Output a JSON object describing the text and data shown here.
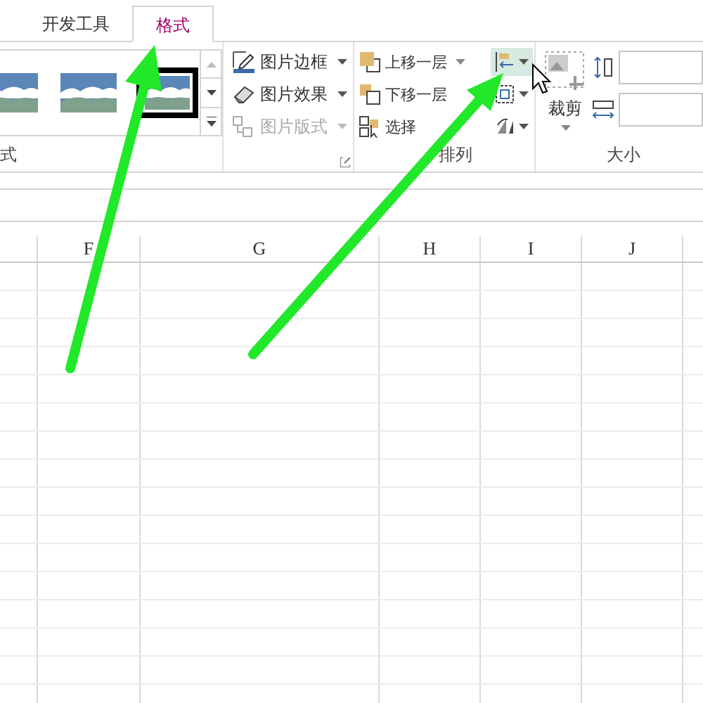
{
  "tabs": [
    {
      "label": "开发工具",
      "selected": false
    },
    {
      "label": "格式",
      "selected": true
    }
  ],
  "style_group": {
    "label": "式",
    "thumbnails": [
      {
        "selected": false
      },
      {
        "selected": false
      },
      {
        "selected": true
      }
    ]
  },
  "picture_commands": [
    {
      "kind": "border",
      "label": "图片边框",
      "disabled": false
    },
    {
      "kind": "effects",
      "label": "图片效果",
      "disabled": false
    },
    {
      "kind": "layout",
      "label": "图片版式",
      "disabled": true
    }
  ],
  "arrange_group": {
    "label": "排列",
    "commands": [
      {
        "kind": "forward",
        "label": "上移一层"
      },
      {
        "kind": "backward",
        "label": "下移一层"
      },
      {
        "kind": "pane",
        "label": "选择"
      }
    ],
    "tools": [
      {
        "kind": "align",
        "hovered": true
      },
      {
        "kind": "group",
        "hovered": false
      },
      {
        "kind": "rotate",
        "hovered": false
      }
    ]
  },
  "size_group": {
    "label": "大小",
    "crop_label": "裁剪"
  },
  "columns": [
    "F",
    "G",
    "H",
    "I",
    "J"
  ]
}
